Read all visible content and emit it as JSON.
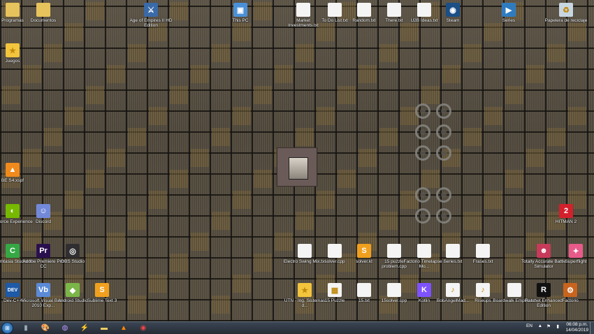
{
  "desktop_icons": [
    {
      "name": "programas",
      "label": "Programas",
      "icon": "folder-icon",
      "color": "#e6c35c"
    },
    {
      "name": "documentos",
      "label": "Documentos",
      "icon": "folder-icon",
      "color": "#e6c35c"
    },
    {
      "name": "age-of-empires",
      "label": "Age of Empires II HD Edition",
      "icon": "game-icon",
      "color": "#3a6aa8"
    },
    {
      "name": "this-pc",
      "label": "This PC",
      "icon": "computer-icon",
      "color": "#4a90d8"
    },
    {
      "name": "market-investments",
      "label": "Market Investments.txt",
      "icon": "text-file-icon",
      "color": "#f4f4f4"
    },
    {
      "name": "todo-list",
      "label": "To Do List.txt",
      "icon": "text-file-icon",
      "color": "#f4f4f4"
    },
    {
      "name": "random",
      "label": "Random.txt",
      "icon": "text-file-icon",
      "color": "#f4f4f4"
    },
    {
      "name": "there",
      "label": "There.txt",
      "icon": "text-file-icon",
      "color": "#f4f4f4"
    },
    {
      "name": "u2b-ideas",
      "label": "U2B Ideas.txt",
      "icon": "text-file-icon",
      "color": "#f4f4f4"
    },
    {
      "name": "steam",
      "label": "Steam",
      "icon": "steam-icon",
      "color": "#1b4f86"
    },
    {
      "name": "series-top",
      "label": "Series",
      "icon": "media-icon",
      "color": "#2f7bc0"
    },
    {
      "name": "recycle-bin",
      "label": "Papelera de reciclaje",
      "icon": "recycle-bin-icon",
      "color": "#c8d6e2"
    },
    {
      "name": "juegos",
      "label": "Juegos",
      "icon": "star-icon",
      "color": "#f2c53d"
    },
    {
      "name": "bes4",
      "label": "BE S4.xspf",
      "icon": "vlc-icon",
      "color": "#f08a1c"
    },
    {
      "name": "geforce",
      "label": "Geforce Experience",
      "icon": "nvidia-icon",
      "color": "#76b900"
    },
    {
      "name": "discord",
      "label": "Discord",
      "icon": "discord-icon",
      "color": "#7289da"
    },
    {
      "name": "hitman",
      "label": "HITMAN 2",
      "icon": "hitman-icon",
      "color": "#d3202c"
    },
    {
      "name": "camtasia",
      "label": "Camtasia Studio 8",
      "icon": "camtasia-icon",
      "color": "#35a845"
    },
    {
      "name": "premiere",
      "label": "Adobe Premiere Pro CC",
      "icon": "premiere-icon",
      "color": "#2a0f4e"
    },
    {
      "name": "obs",
      "label": "OBS Studio",
      "icon": "obs-icon",
      "color": "#302e31"
    },
    {
      "name": "electro-swing",
      "label": "Electro Swing Mix.txt",
      "icon": "text-file-icon",
      "color": "#f4f4f4"
    },
    {
      "name": "solver-cpp",
      "label": "solver.cpp",
      "icon": "cpp-file-icon",
      "color": "#f4f4f4"
    },
    {
      "name": "solver-kt",
      "label": "solver.kt",
      "icon": "sublime-file-icon",
      "color": "#f0a01e"
    },
    {
      "name": "puzzle-problem",
      "label": "15 puzzle problem.cpp",
      "icon": "cpp-file-icon",
      "color": "#f4f4f4"
    },
    {
      "name": "factorio-timelapse",
      "label": "Factorio Timelapse - Mo...",
      "icon": "text-file-icon",
      "color": "#f4f4f4"
    },
    {
      "name": "series-txt",
      "label": "Series.txt",
      "icon": "text-file-icon",
      "color": "#f4f4f4"
    },
    {
      "name": "frases",
      "label": "Frases.txt",
      "icon": "text-file-icon",
      "color": "#f4f4f4"
    },
    {
      "name": "tabs",
      "label": "Totally Accurate Battle Simulator",
      "icon": "tabs-icon",
      "color": "#c83a5a"
    },
    {
      "name": "superflight",
      "label": "Superflight",
      "icon": "superflight-icon",
      "color": "#e85a8a"
    },
    {
      "name": "devcpp",
      "label": "Dev-C++",
      "icon": "devcpp-icon",
      "color": "#1d5aa8"
    },
    {
      "name": "visual-basic",
      "label": "Microsoft Visual Basic 2010 Exp...",
      "icon": "vb-icon",
      "color": "#5a8ad8"
    },
    {
      "name": "android-studio",
      "label": "Android Studio",
      "icon": "android-icon",
      "color": "#7ab648"
    },
    {
      "name": "sublime",
      "label": "Sublime Text 3",
      "icon": "sublime-icon",
      "color": "#f0a01e"
    },
    {
      "name": "utn-sistemas",
      "label": "UTN - Ing. Sistemas d...",
      "icon": "star-icon",
      "color": "#f2c53d"
    },
    {
      "name": "15-puzzle",
      "label": "15 Puzzle",
      "icon": "app-file-icon",
      "color": "#f4f4f4"
    },
    {
      "name": "15-txt",
      "label": "15.txt",
      "icon": "text-file-icon",
      "color": "#f4f4f4"
    },
    {
      "name": "15solver",
      "label": "15solver.cpp",
      "icon": "cpp-file-icon",
      "color": "#f4f4f4"
    },
    {
      "name": "kotlin",
      "label": "Kotlin",
      "icon": "kotlin-icon",
      "color": "#7f52ff"
    },
    {
      "name": "bobangel",
      "label": "BobAngelMad...",
      "icon": "music-file-icon",
      "color": "#f4f4f4"
    },
    {
      "name": "riseups",
      "label": "Riseups",
      "icon": "music-file-icon",
      "color": "#f4f4f4"
    },
    {
      "name": "boardwalk",
      "label": "Boardwalk Empire.txt",
      "icon": "text-file-icon",
      "color": "#f4f4f4"
    },
    {
      "name": "ratchet",
      "label": "Ratchet Enhanced Edition",
      "icon": "ratchet-icon",
      "color": "#111111"
    },
    {
      "name": "factorio",
      "label": "Factorio",
      "icon": "factorio-icon",
      "color": "#c8641e"
    }
  ],
  "taskbar": {
    "start_label": "Start",
    "pinned": [
      {
        "name": "media-center",
        "icon": "media-center-icon"
      },
      {
        "name": "paint",
        "icon": "paint-icon"
      },
      {
        "name": "theme",
        "icon": "theme-icon"
      },
      {
        "name": "winamp",
        "icon": "winamp-icon"
      },
      {
        "name": "explorer",
        "icon": "folder-icon"
      },
      {
        "name": "vlc",
        "icon": "vlc-icon"
      },
      {
        "name": "chrome",
        "icon": "chrome-icon"
      }
    ],
    "language": "EN",
    "time": "06:08 p.m.",
    "date": "14/04/2019"
  }
}
